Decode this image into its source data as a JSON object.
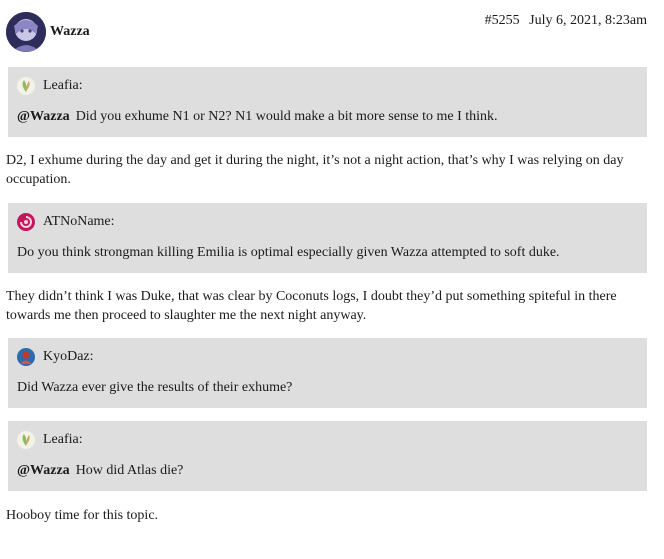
{
  "post": {
    "author": "Wazza",
    "post_number": "#5255",
    "date": "July 6, 2021, 8:23am"
  },
  "blocks": [
    {
      "type": "quote",
      "author": "Leafia:",
      "icon": "leaf-avatar-icon",
      "mention": "@Wazza",
      "text": "Did you exhume N1 or N2? N1 would make a bit more sense to me I think."
    },
    {
      "type": "para",
      "text": "D2, I exhume during the day and get it during the night, it’s not a night action, that’s why I was relying on day occupation."
    },
    {
      "type": "quote",
      "author": "ATNoName:",
      "icon": "red-swirl-avatar-icon",
      "text": "Do you think strongman killing Emilia is optimal especially given Wazza attempted to soft duke."
    },
    {
      "type": "para",
      "text": "They didn’t think I was Duke, that was clear by Coconuts logs, I doubt they’d put something spiteful in there towards me then proceed to slaughter me the next night anyway."
    },
    {
      "type": "quote",
      "author": "KyoDaz:",
      "icon": "person-avatar-icon",
      "text": "Did Wazza ever give the results of their exhume?"
    },
    {
      "type": "quote",
      "author": "Leafia:",
      "icon": "leaf-avatar-icon",
      "mention": "@Wazza",
      "text": "How did Atlas die?"
    },
    {
      "type": "para",
      "text": "Hooboy time for this topic."
    }
  ],
  "colors": {
    "quote_bg": "#dedede",
    "text": "#1a1a1a"
  }
}
